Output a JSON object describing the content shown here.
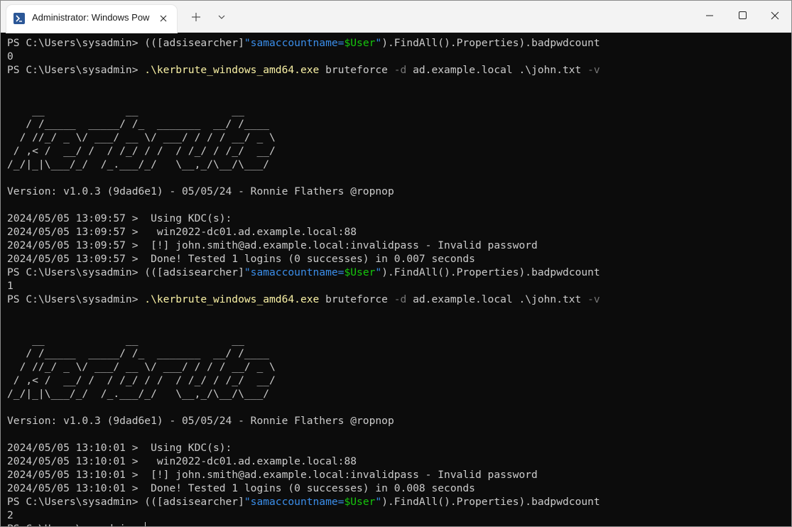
{
  "titlebar": {
    "tab_title": "Administrator: Windows PowerShell",
    "tab_icon": "powershell-icon",
    "new_tab_icon": "plus-icon",
    "dropdown_icon": "chevron-down-icon",
    "window_controls": [
      "minimize-icon",
      "maximize-icon",
      "close-icon"
    ]
  },
  "colors": {
    "background": "#0c0c0c",
    "text": "#cccccc",
    "command": "#f9f1a5",
    "string": "#3b8eea",
    "variable": "#16c60c",
    "parameter": "#767676"
  },
  "terminal": {
    "lines": [
      [
        [
          "t",
          "PS C:\\Users\\sysadmin> (([adsisearcher]"
        ],
        [
          "c",
          "\"samaccountname="
        ],
        [
          "g",
          "$User"
        ],
        [
          "c",
          "\""
        ],
        [
          "t",
          ").FindAll().Properties).badpwdcount"
        ]
      ],
      [
        [
          "t",
          "0"
        ]
      ],
      [
        [
          "t",
          "PS C:\\Users\\sysadmin> "
        ],
        [
          "y",
          ".\\kerbrute_windows_amd64.exe"
        ],
        [
          "t",
          " bruteforce "
        ],
        [
          "d",
          "-d"
        ],
        [
          "t",
          " ad.example.local .\\john.txt "
        ],
        [
          "d",
          "-v"
        ]
      ],
      [],
      [],
      [
        [
          "t",
          "    __             __               __"
        ]
      ],
      [
        [
          "t",
          "   / /_____  _____/ /_  _______  __/ /____"
        ]
      ],
      [
        [
          "t",
          "  / //_/ _ \\/ ___/ __ \\/ ___/ / / / __/ _ \\"
        ]
      ],
      [
        [
          "t",
          " / ,< /  __/ /  / /_/ / /  / /_/ / /_/  __/"
        ]
      ],
      [
        [
          "t",
          "/_/|_|\\___/_/  /_.___/_/   \\__,_/\\__/\\___/"
        ]
      ],
      [],
      [
        [
          "t",
          "Version: v1.0.3 (9dad6e1) - 05/05/24 - Ronnie Flathers @ropnop"
        ]
      ],
      [],
      [
        [
          "t",
          "2024/05/05 13:09:57 >  Using KDC(s):"
        ]
      ],
      [
        [
          "t",
          "2024/05/05 13:09:57 >   win2022-dc01.ad.example.local:88"
        ]
      ],
      [
        [
          "t",
          "2024/05/05 13:09:57 >  [!] john.smith@ad.example.local:invalidpass - Invalid password"
        ]
      ],
      [
        [
          "t",
          "2024/05/05 13:09:57 >  Done! Tested 1 logins (0 successes) in 0.007 seconds"
        ]
      ],
      [
        [
          "t",
          "PS C:\\Users\\sysadmin> (([adsisearcher]"
        ],
        [
          "c",
          "\"samaccountname="
        ],
        [
          "g",
          "$User"
        ],
        [
          "c",
          "\""
        ],
        [
          "t",
          ").FindAll().Properties).badpwdcount"
        ]
      ],
      [
        [
          "t",
          "1"
        ]
      ],
      [
        [
          "t",
          "PS C:\\Users\\sysadmin> "
        ],
        [
          "y",
          ".\\kerbrute_windows_amd64.exe"
        ],
        [
          "t",
          " bruteforce "
        ],
        [
          "d",
          "-d"
        ],
        [
          "t",
          " ad.example.local .\\john.txt "
        ],
        [
          "d",
          "-v"
        ]
      ],
      [],
      [],
      [
        [
          "t",
          "    __             __               __"
        ]
      ],
      [
        [
          "t",
          "   / /_____  _____/ /_  _______  __/ /____"
        ]
      ],
      [
        [
          "t",
          "  / //_/ _ \\/ ___/ __ \\/ ___/ / / / __/ _ \\"
        ]
      ],
      [
        [
          "t",
          " / ,< /  __/ /  / /_/ / /  / /_/ / /_/  __/"
        ]
      ],
      [
        [
          "t",
          "/_/|_|\\___/_/  /_.___/_/   \\__,_/\\__/\\___/"
        ]
      ],
      [],
      [
        [
          "t",
          "Version: v1.0.3 (9dad6e1) - 05/05/24 - Ronnie Flathers @ropnop"
        ]
      ],
      [],
      [
        [
          "t",
          "2024/05/05 13:10:01 >  Using KDC(s):"
        ]
      ],
      [
        [
          "t",
          "2024/05/05 13:10:01 >   win2022-dc01.ad.example.local:88"
        ]
      ],
      [
        [
          "t",
          "2024/05/05 13:10:01 >  [!] john.smith@ad.example.local:invalidpass - Invalid password"
        ]
      ],
      [
        [
          "t",
          "2024/05/05 13:10:01 >  Done! Tested 1 logins (0 successes) in 0.008 seconds"
        ]
      ],
      [
        [
          "t",
          "PS C:\\Users\\sysadmin> (([adsisearcher]"
        ],
        [
          "c",
          "\"samaccountname="
        ],
        [
          "g",
          "$User"
        ],
        [
          "c",
          "\""
        ],
        [
          "t",
          ").FindAll().Properties).badpwdcount"
        ]
      ],
      [
        [
          "t",
          "2"
        ]
      ],
      [
        [
          "t",
          "PS C:\\Users\\sysadmin> "
        ]
      ]
    ]
  }
}
